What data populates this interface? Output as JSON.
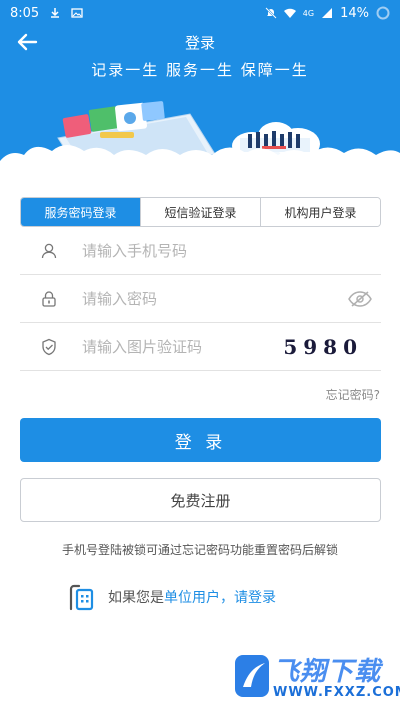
{
  "status_bar": {
    "time": "8:05",
    "network": "4G",
    "battery": "14%"
  },
  "header": {
    "title": "登录",
    "slogan": "记录一生 服务一生 保障一生"
  },
  "tabs": [
    {
      "label": "服务密码登录",
      "active": true
    },
    {
      "label": "短信验证登录",
      "active": false
    },
    {
      "label": "机构用户登录",
      "active": false
    }
  ],
  "form": {
    "phone_placeholder": "请输入手机号码",
    "password_placeholder": "请输入密码",
    "captcha_placeholder": "请输入图片验证码",
    "captcha_value": "5980",
    "forgot_label": "忘记密码?"
  },
  "buttons": {
    "login_label": "登 录",
    "register_label": "免费注册"
  },
  "notice": "手机号登陆被锁可通过忘记密码功能重置密码后解锁",
  "org": {
    "prefix": "如果您是",
    "unit_user": "单位用户，",
    "login_link": "请登录"
  },
  "watermark": {
    "brand": "飞翔下载",
    "url": "WWW.FXXZ.COM"
  },
  "colors": {
    "primary": "#1e8ee4",
    "border": "#c9cdd3"
  }
}
